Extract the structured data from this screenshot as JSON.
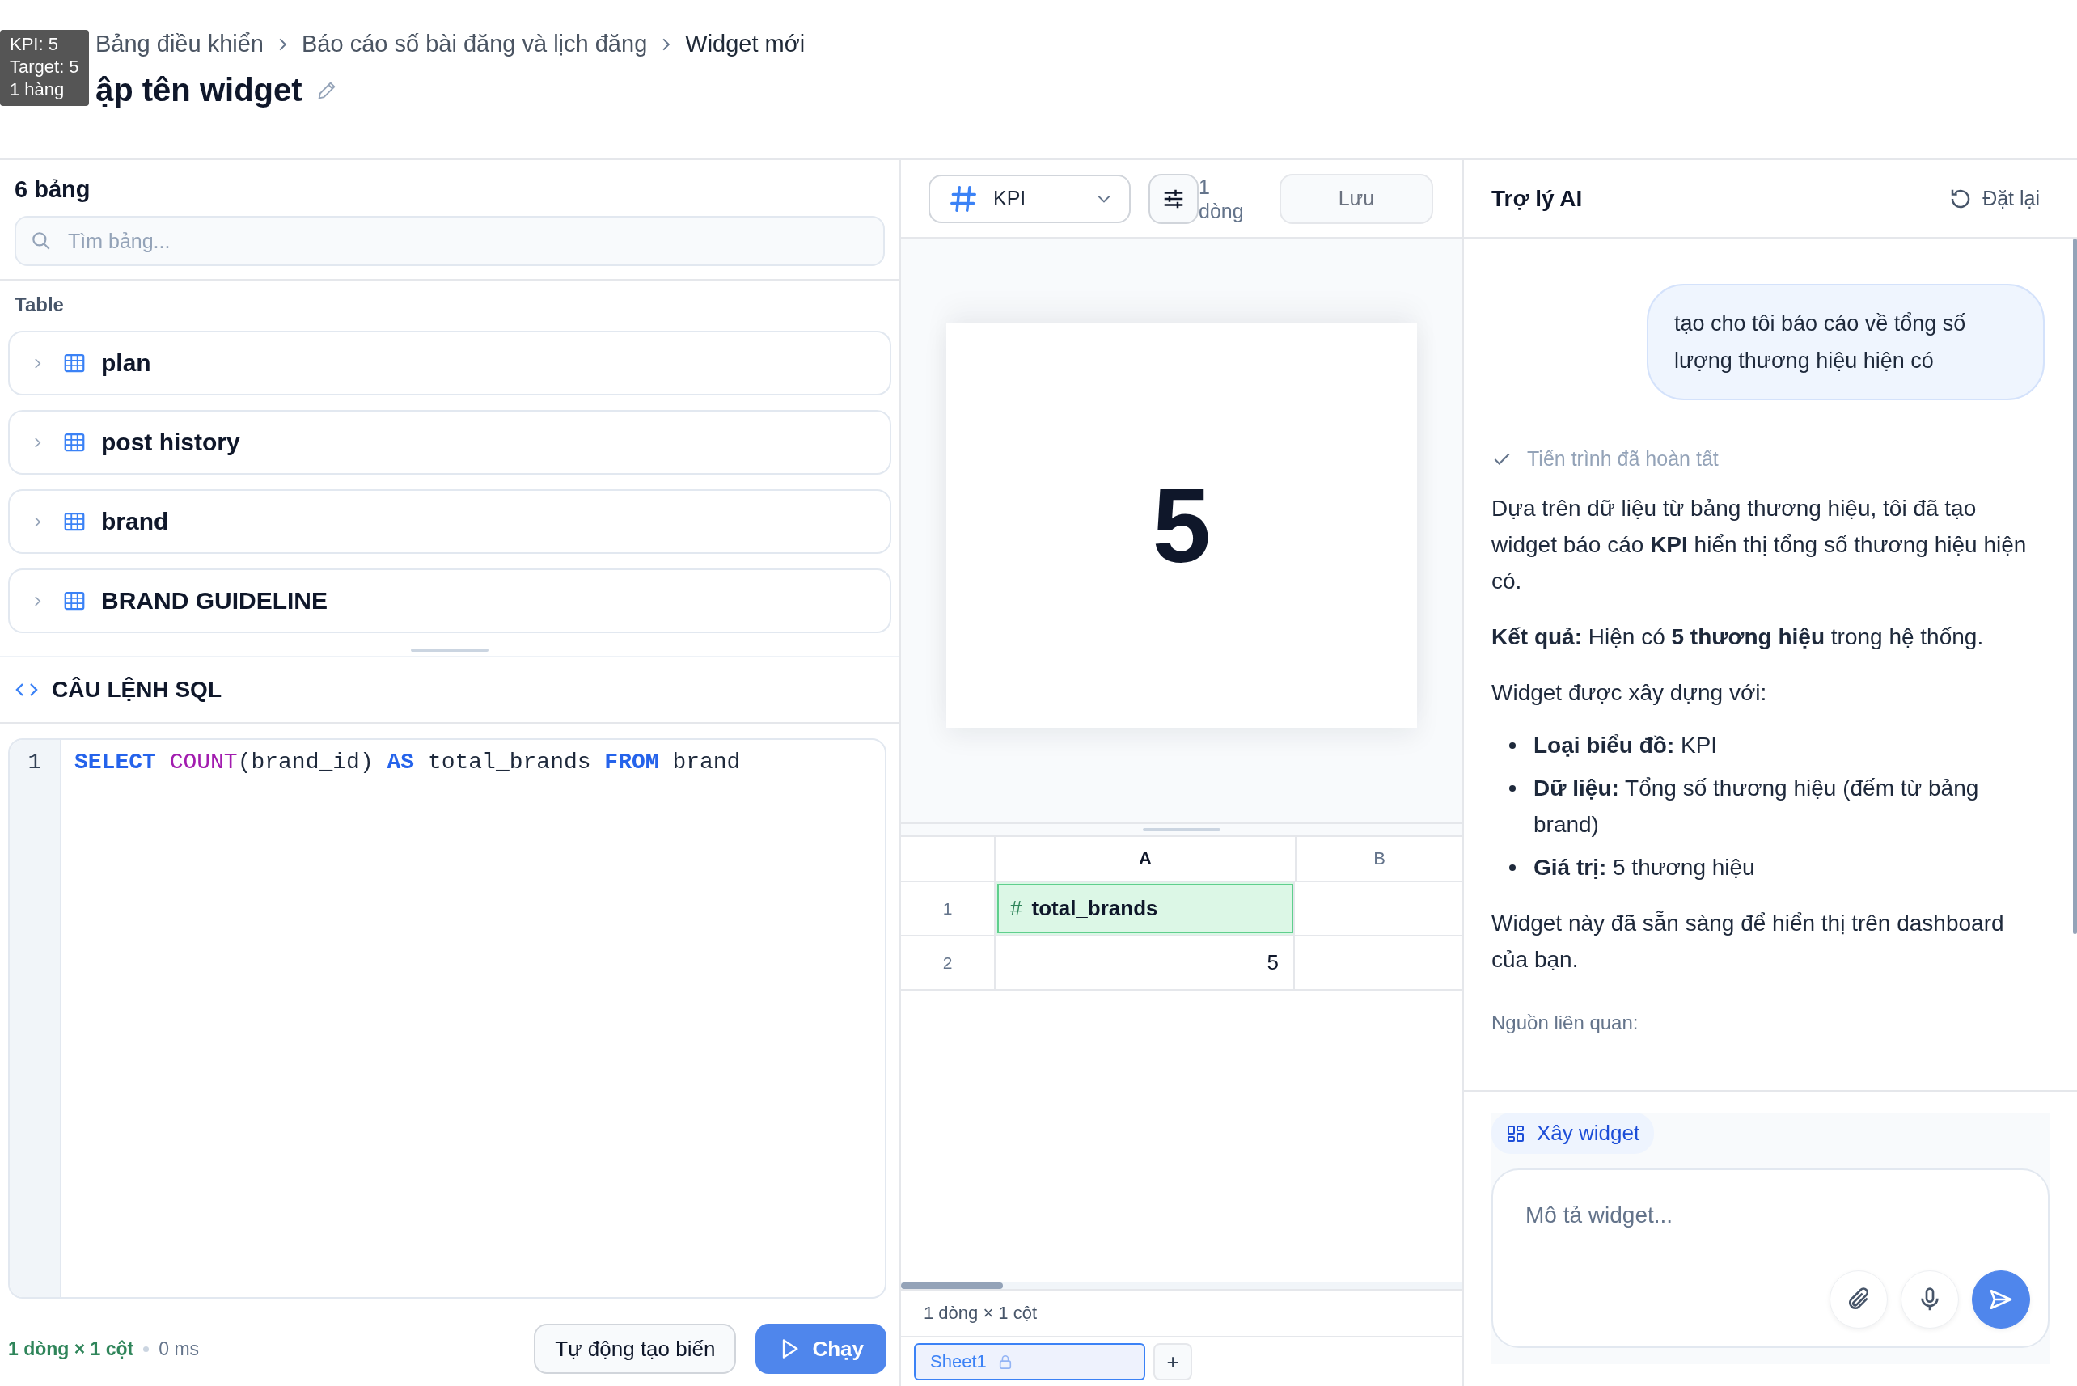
{
  "tooltip": {
    "lines": [
      "KPI: 5",
      "Target: 5",
      "1 hàng"
    ]
  },
  "breadcrumb": [
    {
      "label": "Bảng điều khiển"
    },
    {
      "label": "Báo cáo số bài đăng và lịch đăng"
    },
    {
      "label": "Widget mới"
    }
  ],
  "title": "ập tên widget",
  "tables_panel": {
    "count_label": "6 bảng",
    "search": {
      "placeholder": "Tìm bảng..."
    },
    "group_label": "Table",
    "tables": [
      {
        "name": "plan",
        "expanded": false
      },
      {
        "name": "post history",
        "expanded": false
      },
      {
        "name": "brand",
        "expanded": false
      },
      {
        "name": "BRAND GUIDELINE",
        "expanded": false
      }
    ]
  },
  "sql": {
    "header": "CÂU LỆNH SQL",
    "lines": [
      {
        "number": "1",
        "tokens": [
          {
            "text": "SELECT",
            "kind": "keyword"
          },
          {
            "text": " COUNT",
            "kind": "function"
          },
          {
            "text": "(brand_id) ",
            "kind": "plain"
          },
          {
            "text": "AS",
            "kind": "keyword"
          },
          {
            "text": " total_brands ",
            "kind": "plain"
          },
          {
            "text": "FROM",
            "kind": "keyword"
          },
          {
            "text": " brand",
            "kind": "plain"
          }
        ]
      }
    ]
  },
  "query_status": {
    "result": "1 dòng × 1 cột",
    "time": "0 ms"
  },
  "query_buttons": [
    {
      "label": "Tự động tạo biến",
      "kind": "secondary"
    },
    {
      "label": "Chạy",
      "kind": "primary"
    }
  ],
  "widget_toolbar": {
    "chart_type": "KPI",
    "rows_label": "1 dòng",
    "save": {
      "label": "Lưu",
      "disabled": true
    }
  },
  "kpi": {
    "value": "5"
  },
  "grid": {
    "columns": [
      "A",
      "B"
    ],
    "rows": [
      {
        "number": "1",
        "cell_a": {
          "kind": "field",
          "icon": "#",
          "text": "total_brands",
          "selected": true
        }
      },
      {
        "number": "2",
        "cell_a": {
          "kind": "number",
          "text": "5",
          "selected": false
        }
      }
    ],
    "footer": "1 dòng × 1 cột",
    "sheets": [
      {
        "label": "Sheet1",
        "selected": true,
        "locked": true
      }
    ],
    "add_sheet": "+"
  },
  "assistant": {
    "title": "Trợ lý AI",
    "reset": "Đặt lại",
    "user_message": "tạo cho tôi báo cáo về tổng số lượng thương hiệu hiện có",
    "progress": {
      "text": "Tiến trình đã hoàn tất",
      "done": true
    },
    "blocks": [
      {
        "kind": "paragraph",
        "text": "Dựa trên dữ liệu từ bảng thương hiệu, tôi đã tạo widget báo cáo **KPI** hiển thị tổng số thương hiệu hiện có."
      },
      {
        "kind": "paragraph",
        "text": "**Kết quả:** Hiện có **5 thương hiệu** trong hệ thống."
      },
      {
        "kind": "paragraph",
        "text": "Widget được xây dựng với:"
      },
      {
        "kind": "list",
        "items": [
          "**Loại biểu đồ:** KPI",
          "**Dữ liệu:** Tổng số thương hiệu (đếm từ bảng brand)",
          "**Giá trị:** 5 thương hiệu"
        ]
      },
      {
        "kind": "paragraph",
        "text": "Widget này đã sẵn sàng để hiển thị trên dashboard của bạn."
      },
      {
        "kind": "caption",
        "text": "Nguồn liên quan:"
      }
    ],
    "mode_chip": "Xây widget",
    "composer": {
      "placeholder": "Mô tả widget..."
    }
  }
}
